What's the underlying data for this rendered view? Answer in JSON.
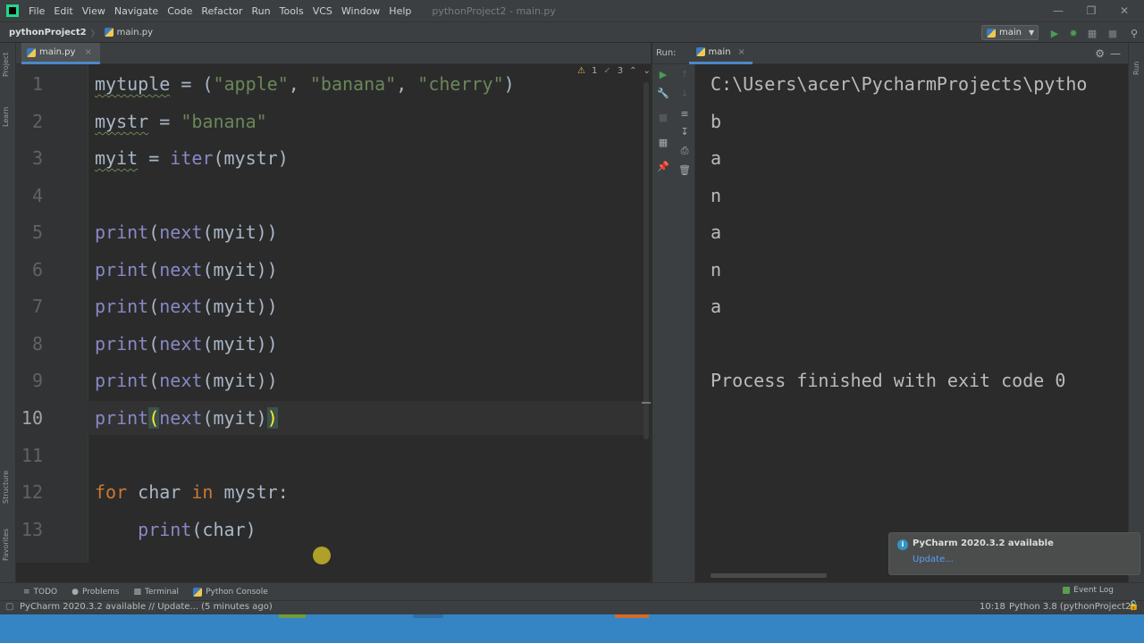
{
  "menubar": {
    "items": [
      "File",
      "Edit",
      "View",
      "Navigate",
      "Code",
      "Refactor",
      "Run",
      "Tools",
      "VCS",
      "Window",
      "Help"
    ],
    "window_title": "pythonProject2 - main.py"
  },
  "navbar": {
    "project": "pythonProject2",
    "separator": "〉",
    "file": "main.py",
    "run_config": "main"
  },
  "left_stripe": {
    "project_label": "Project",
    "learn_label": "Learn",
    "structure_label": "Structure",
    "favorites_label": "Favorites"
  },
  "right_stripe": {
    "run_label": "Run"
  },
  "editor": {
    "tab_label": "main.py",
    "tab_close": "×",
    "inspections": {
      "warnings": "1",
      "typos": "3"
    },
    "line_numbers": [
      "1",
      "2",
      "3",
      "4",
      "5",
      "6",
      "7",
      "8",
      "9",
      "10",
      "11",
      "12",
      "13"
    ],
    "current_line": "10"
  },
  "run_panel": {
    "label": "Run:",
    "tab_label": "main",
    "tab_close": "×",
    "output": [
      "C:\\Users\\acer\\PycharmProjects\\pytho",
      "b",
      "a",
      "n",
      "a",
      "n",
      "a",
      "",
      "Process finished with exit code 0"
    ]
  },
  "notification": {
    "title": "PyCharm 2020.3.2 available",
    "link": "Update..."
  },
  "bottom_bar": {
    "todo": "TODO",
    "problems": "Problems",
    "terminal": "Terminal",
    "python_console": "Python Console",
    "event_log": "Event Log"
  },
  "statusbar": {
    "message": "PyCharm 2020.3.2 available // Update... (5 minutes ago)",
    "position": "10:18",
    "interpreter": "Python 3.8 (pythonProject2)"
  },
  "colors": {
    "accent": "#4a88c7",
    "string": "#6a8759",
    "builtin": "#8888c6",
    "keyword": "#cc7832",
    "run_green": "#499c54",
    "taskbar": "#3585c4"
  }
}
